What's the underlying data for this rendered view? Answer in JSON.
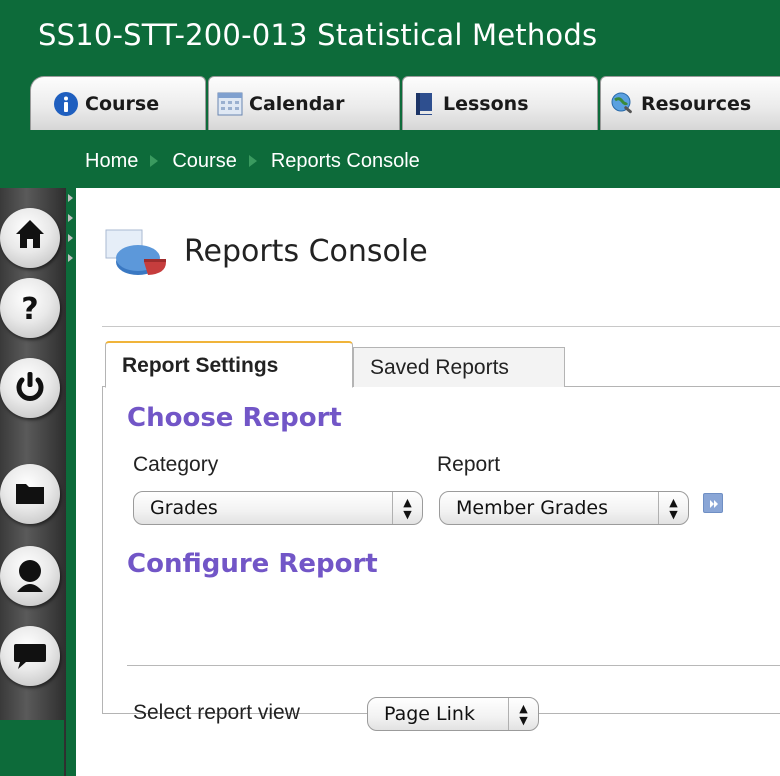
{
  "course": {
    "title": "SS10-STT-200-013 Statistical Methods"
  },
  "tabs": [
    {
      "label": "Course",
      "icon": "info-icon"
    },
    {
      "label": "Calendar",
      "icon": "calendar-icon"
    },
    {
      "label": "Lessons",
      "icon": "book-icon"
    },
    {
      "label": "Resources",
      "icon": "globe-search-icon"
    }
  ],
  "breadcrumb": [
    "Home",
    "Course",
    "Reports Console"
  ],
  "rail": {
    "buttons": [
      "home-icon",
      "help-icon",
      "power-icon",
      "folder-icon",
      "person-icon",
      "chat-icon"
    ]
  },
  "page": {
    "title": "Reports Console"
  },
  "report_tabs": [
    "Report Settings",
    "Saved Reports"
  ],
  "choose_report": {
    "heading": "Choose Report",
    "category_label": "Category",
    "category_value": "Grades",
    "report_label": "Report",
    "report_value": "Member Grades"
  },
  "configure_report": {
    "heading": "Configure Report"
  },
  "report_view": {
    "label": "Select report view",
    "value": "Page Link"
  },
  "colors": {
    "brand_green": "#0d6b3a",
    "heading_purple": "#7256c7",
    "active_tab_accent": "#f0b43a"
  }
}
